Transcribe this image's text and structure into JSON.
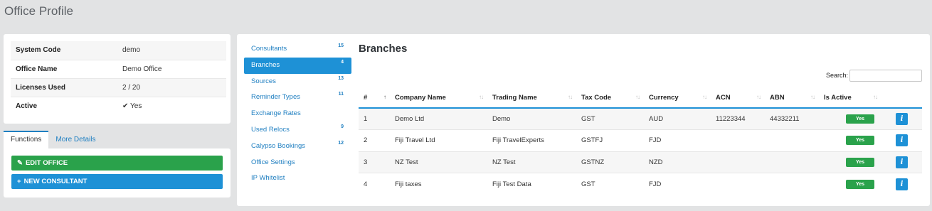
{
  "page": {
    "title": "Office Profile"
  },
  "office_info": [
    {
      "label": "System Code",
      "value": "demo"
    },
    {
      "label": "Office Name",
      "value": "Demo Office"
    },
    {
      "label": "Licenses Used",
      "value": "2 / 20"
    },
    {
      "label": "Active",
      "value": "Yes"
    }
  ],
  "function_tabs": [
    {
      "label": "Functions",
      "active": true
    },
    {
      "label": "More Details",
      "active": false
    }
  ],
  "buttons": {
    "edit_office": "Edit Office",
    "new_consultant": "New Consultant"
  },
  "nav": [
    {
      "label": "Consultants",
      "count": "15"
    },
    {
      "label": "Branches",
      "count": "4",
      "active": true
    },
    {
      "label": "Sources",
      "count": "13"
    },
    {
      "label": "Reminder Types",
      "count": "11"
    },
    {
      "label": "Exchange Rates",
      "count": ""
    },
    {
      "label": "Used Relocs",
      "count": "9"
    },
    {
      "label": "Calypso Bookings",
      "count": "12"
    },
    {
      "label": "Office Settings",
      "count": ""
    },
    {
      "label": "IP Whitelist",
      "count": ""
    }
  ],
  "branches": {
    "title": "Branches",
    "search_label": "Search:",
    "search_value": "",
    "columns": [
      "#",
      "Company Name",
      "Trading Name",
      "Tax Code",
      "Currency",
      "ACN",
      "ABN",
      "Is Active"
    ],
    "rows": [
      {
        "num": "1",
        "company": "Demo Ltd",
        "trading": "Demo",
        "tax": "GST",
        "currency": "AUD",
        "acn": "11223344",
        "abn": "44332211",
        "active": "Yes"
      },
      {
        "num": "2",
        "company": "Fiji Travel Ltd",
        "trading": "Fiji TravelExperts",
        "tax": "GSTFJ",
        "currency": "FJD",
        "acn": "",
        "abn": "",
        "active": "Yes"
      },
      {
        "num": "3",
        "company": "NZ Test",
        "trading": "NZ Test",
        "tax": "GSTNZ",
        "currency": "NZD",
        "acn": "",
        "abn": "",
        "active": "Yes"
      },
      {
        "num": "4",
        "company": "Fiji taxes",
        "trading": "Fiji Test Data",
        "tax": "GST",
        "currency": "FJD",
        "acn": "",
        "abn": "",
        "active": "Yes"
      }
    ]
  },
  "colors": {
    "primary": "#1e91d6",
    "success": "#2aa24b",
    "background": "#e2e3e4"
  }
}
